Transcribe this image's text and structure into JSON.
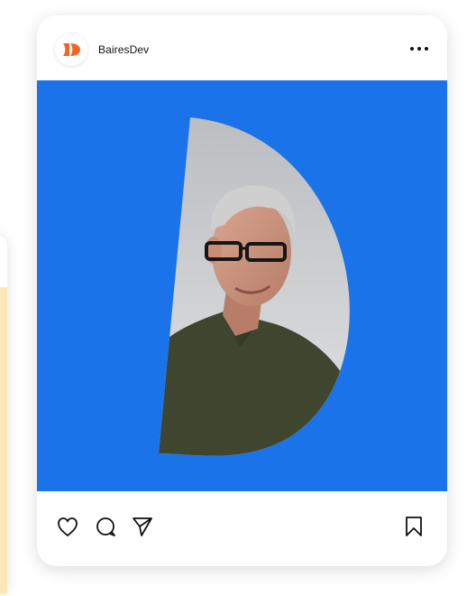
{
  "post": {
    "account_name": "BairesDev",
    "brand_color": "#f26522",
    "media_background": "#1a73e8",
    "media_subject": "man-with-glasses-photo",
    "header_icons": {
      "avatar": "bairesdev-logo-icon",
      "menu": "more-dots-icon"
    },
    "action_icons": {
      "like": "heart-icon",
      "comment": "comment-icon",
      "share": "send-icon",
      "save": "bookmark-icon"
    }
  }
}
